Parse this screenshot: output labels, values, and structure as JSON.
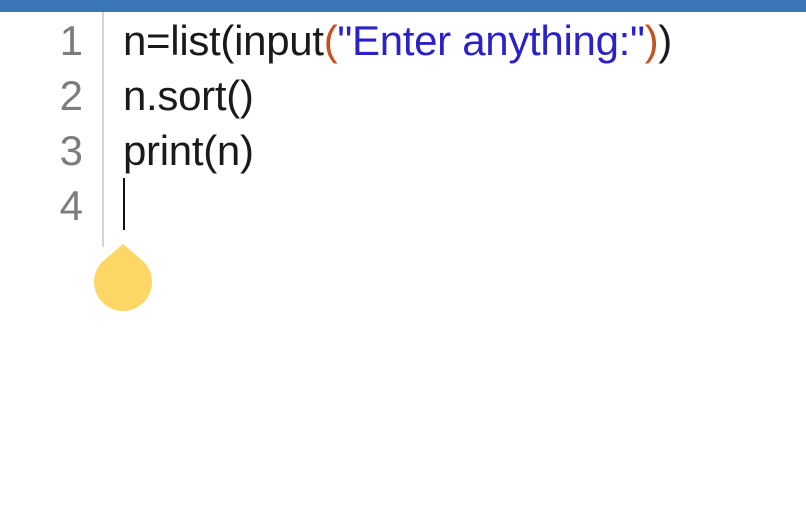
{
  "editor": {
    "lines": [
      {
        "number": "1",
        "tokens": {
          "prefix": "n=list(input",
          "open_paren": "(",
          "string": "\"Enter anything:\"",
          "close_paren": ")",
          "suffix": ")"
        }
      },
      {
        "number": "2",
        "code": "n.sort()"
      },
      {
        "number": "3",
        "code": "print(n)"
      },
      {
        "number": "4",
        "code": ""
      }
    ]
  },
  "colors": {
    "top_bar": "#3b76b6",
    "line_number": "#7d7d7d",
    "code_text": "#1a1a1a",
    "paren_accent": "#c4531e",
    "string_literal": "#2b21c9",
    "caret_handle": "#fdd766"
  }
}
